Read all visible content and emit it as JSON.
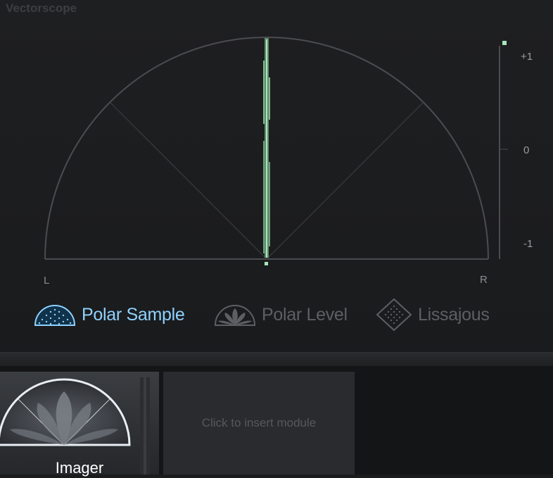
{
  "panel": {
    "title": "Vectorscope"
  },
  "scope": {
    "left_label": "L",
    "right_label": "R",
    "meter_ticks": [
      "+1",
      "0",
      "-1"
    ],
    "correlation_value": 1.0,
    "trace_color": "#a8e6b8",
    "grid_color": "#4a4c50"
  },
  "modes": [
    {
      "label": "Polar Sample",
      "icon": "polar-sample-icon",
      "active": true
    },
    {
      "label": "Polar Level",
      "icon": "polar-level-icon",
      "active": false
    },
    {
      "label": "Lissajous",
      "icon": "lissajous-icon",
      "active": false
    }
  ],
  "module_strip": {
    "current_module": "Imager",
    "insert_slot_text": "Click to insert module"
  },
  "colors": {
    "active_mode": "#8fd2ff",
    "inactive_mode": "#5c5f63",
    "background": "#1b1c1e"
  }
}
